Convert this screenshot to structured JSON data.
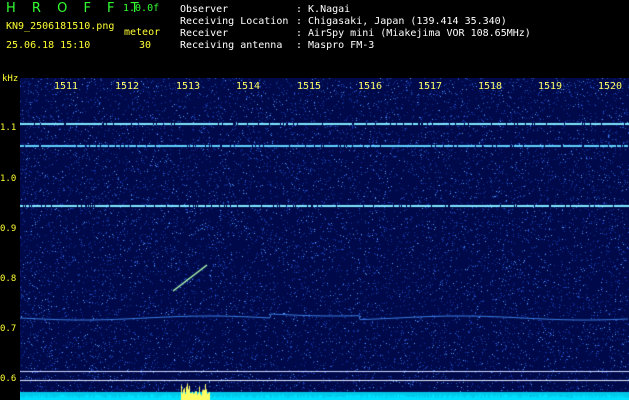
{
  "header": {
    "app_title": "H R O F F T",
    "version": "1.0.0f",
    "filename": "KN9_2506181510.png",
    "datetime": "25.06.18 15:10",
    "mode_label": "meteor",
    "mode_value": "30",
    "info": [
      {
        "label": "Observer",
        "value": ": K.Nagai"
      },
      {
        "label": "Receiving Location",
        "value": ": Chigasaki, Japan (139.414 35.340)"
      },
      {
        "label": "Receiver",
        "value": ": AirSpy mini (Miakejima VOR 108.65MHz)"
      },
      {
        "label": "Receiving antenna",
        "value": ": Maspro FM-3"
      }
    ]
  },
  "y_axis": {
    "unit": "kHz",
    "ticks": [
      "1.1",
      "1.0",
      "0.9",
      "0.8",
      "0.7",
      "0.6"
    ]
  },
  "time_axis": {
    "ticks": [
      "1511",
      "1512",
      "1513",
      "1514",
      "1515",
      "1516",
      "1517",
      "1518",
      "1519",
      "1520"
    ]
  },
  "colors": {
    "background": "#000a4a",
    "signal": "#33ccff",
    "text": "#ffff33"
  }
}
